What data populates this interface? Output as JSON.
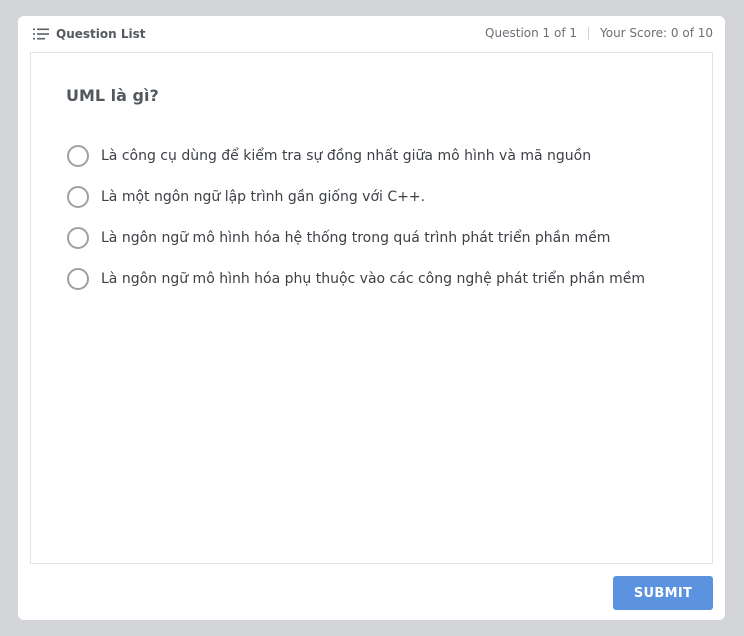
{
  "header": {
    "question_list_label": "Question List",
    "question_counter": "Question 1 of 1",
    "score": "Your Score: 0 of 10"
  },
  "question": {
    "text": "UML là gì?",
    "options": [
      {
        "label": "Là công cụ dùng để kiểm tra sự đồng nhất giữa mô hình và mã nguồn",
        "selected": false
      },
      {
        "label": "Là một ngôn ngữ lập trình gần giống với C++.",
        "selected": false
      },
      {
        "label": "Là ngôn ngữ mô hình hóa hệ thống trong quá trình phát triển phần mềm",
        "selected": false
      },
      {
        "label": "Là ngôn ngữ mô hình hóa phụ thuộc vào các công nghệ phát triển phần mềm",
        "selected": false
      }
    ]
  },
  "actions": {
    "submit_label": "SUBMIT"
  },
  "icons": {
    "question_list": "list-icon",
    "option": "radio-button-icon"
  },
  "colors": {
    "background": "#d3d5d8",
    "accent": "#5b93e0"
  }
}
